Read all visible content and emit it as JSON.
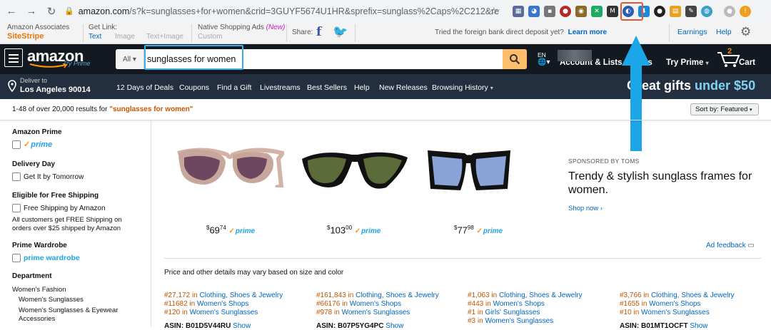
{
  "browser": {
    "url_host": "amazon.com",
    "url_rest": "/s?k=sunglasses+for+women&crid=3GUYF5674U1HR&sprefix=sunglass%2Caps%2C212&ref=nb_s..."
  },
  "sitestripe": {
    "brand_top": "Amazon Associates",
    "brand_bottom": "SiteStripe",
    "get_link": "Get Link:",
    "opt_text": "Text",
    "opt_image": "Image",
    "opt_text_image": "Text+Image",
    "native_ads": "Native Shopping Ads",
    "native_new": "(New)",
    "custom": "Custom",
    "share": "Share:",
    "promo": "Tried the foreign bank direct deposit yet?",
    "learn_more": "Learn more",
    "earnings": "Earnings",
    "help": "Help"
  },
  "header": {
    "logo": "amazon",
    "logo_sub": "Try Prime",
    "search_category": "All",
    "search_value": "sunglasses for women",
    "lang": "EN",
    "account": "Account & Lists",
    "orders": "Orders",
    "try_prime": "Try Prime",
    "cart_count": "2",
    "cart": "Cart"
  },
  "subnav": {
    "deliver_top": "Deliver to",
    "deliver_bottom": "Los Angeles 90014",
    "links": [
      "12 Days of Deals",
      "Coupons",
      "Find a Gift",
      "Livestreams",
      "Best Sellers",
      "Help",
      "New Releases",
      "Browsing History"
    ],
    "promo_left": "Great gifts",
    "promo_right": "under $50"
  },
  "results": {
    "count": "1-48 of over 20,000 results for",
    "query": "\"sunglasses for women\"",
    "sort": "Sort by: Featured"
  },
  "sidebar": {
    "amazon_prime": "Amazon Prime",
    "prime": "prime",
    "delivery_day": "Delivery Day",
    "get_tomorrow": "Get It by Tomorrow",
    "free_shipping_h": "Eligible for Free Shipping",
    "free_shipping": "Free Shipping by Amazon",
    "free_shipping_note": "All customers get FREE Shipping on orders over $25 shipped by Amazon",
    "prime_wardrobe_h": "Prime Wardrobe",
    "prime_wardrobe": "prime wardrobe",
    "department": "Department",
    "dept_items": [
      "Women's Fashion",
      "Women's Sunglasses",
      "Women's Sunglasses & Eyewear Accessories"
    ]
  },
  "sponsored": {
    "label": "SPONSORED BY TOMS",
    "headline": "Trendy & stylish sunglass frames for women.",
    "shop_now": "Shop now ›",
    "ad_feedback": "Ad feedback",
    "products": [
      {
        "dollars": "69",
        "cents": "74",
        "prime": "prime"
      },
      {
        "dollars": "103",
        "cents": "00",
        "prime": "prime"
      },
      {
        "dollars": "77",
        "cents": "98",
        "prime": "prime"
      }
    ]
  },
  "note": "Price and other details may vary based on size and color",
  "ranks": [
    [
      "#27,172",
      "Clothing, Shoes & Jewelry",
      "#11682",
      "Women's Shops",
      "#120",
      "Women's Sunglasses"
    ],
    [
      "#161,843",
      "Clothing, Shoes & Jewelry",
      "#66176",
      "Women's Shops",
      "#978",
      "Women's Sunglasses"
    ],
    [
      "#1,063",
      "Clothing, Shoes & Jewelry",
      "#443",
      "Women's Shops",
      "#1",
      "Girls' Sunglasses",
      "#3",
      "Women's Sunglasses"
    ],
    [
      "#3,766",
      "Clothing, Shoes & Jewelry",
      "#1655",
      "Women's Shops",
      "#10",
      "Women's Sunglasses"
    ]
  ],
  "rank_in": "in",
  "asins": [
    {
      "label": "ASIN:",
      "value": "B01D5V44RU",
      "show": "Show"
    },
    {
      "label": "ASIN:",
      "value": "B07P5YG4PC",
      "show": "Show"
    },
    {
      "label": "ASIN:",
      "value": "",
      "show": "Show"
    },
    {
      "label": "ASIN:",
      "value": "B01MT1OCFT",
      "show": "Show"
    }
  ]
}
